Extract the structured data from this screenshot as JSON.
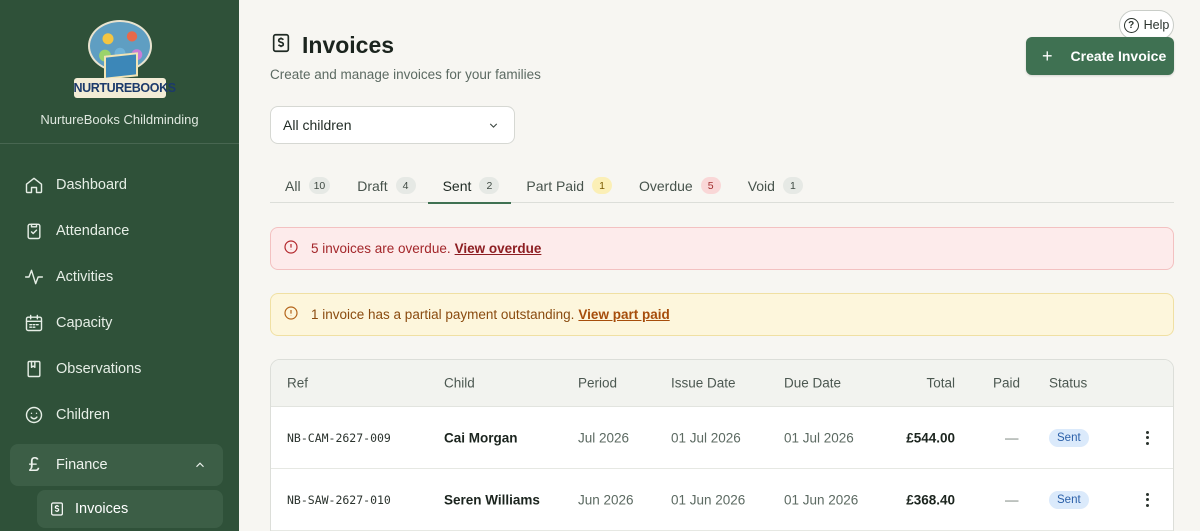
{
  "brand": {
    "logo_text": "NURTUREBOOKS",
    "name": "NurtureBooks Childminding"
  },
  "nav": {
    "items": [
      {
        "label": "Dashboard",
        "icon": "home-icon"
      },
      {
        "label": "Attendance",
        "icon": "clipboard-check-icon"
      },
      {
        "label": "Activities",
        "icon": "activity-icon"
      },
      {
        "label": "Capacity",
        "icon": "calendar-icon"
      },
      {
        "label": "Observations",
        "icon": "book-icon"
      },
      {
        "label": "Children",
        "icon": "smile-icon"
      }
    ],
    "group": {
      "label": "Finance",
      "icon": "pound-icon",
      "expanded": true
    },
    "sub": {
      "label": "Invoices",
      "icon": "invoice-icon"
    }
  },
  "header": {
    "help_label": "Help",
    "title": "Invoices",
    "subtitle": "Create and manage invoices for your families",
    "create_label": "Create Invoice"
  },
  "filter": {
    "selected": "All children"
  },
  "tabs": [
    {
      "label": "All",
      "count": "10"
    },
    {
      "label": "Draft",
      "count": "4"
    },
    {
      "label": "Sent",
      "count": "2"
    },
    {
      "label": "Part Paid",
      "count": "1"
    },
    {
      "label": "Overdue",
      "count": "5"
    },
    {
      "label": "Void",
      "count": "1"
    }
  ],
  "alerts": {
    "overdue": {
      "text": "5 invoices are overdue.",
      "link": "View overdue"
    },
    "part_paid": {
      "text": "1 invoice has a partial payment outstanding.",
      "link": "View part paid"
    }
  },
  "table": {
    "headers": {
      "ref": "Ref",
      "child": "Child",
      "period": "Period",
      "issue": "Issue Date",
      "due": "Due Date",
      "total": "Total",
      "paid": "Paid",
      "status": "Status"
    },
    "rows": [
      {
        "ref": "NB-CAM-2627-009",
        "child": "Cai Morgan",
        "period": "Jul 2026",
        "issue": "01 Jul 2026",
        "due": "01 Jul 2026",
        "total": "£544.00",
        "paid": "—",
        "status": "Sent"
      },
      {
        "ref": "NB-SAW-2627-010",
        "child": "Seren Williams",
        "period": "Jun 2026",
        "issue": "01 Jun 2026",
        "due": "01 Jun 2026",
        "total": "£368.40",
        "paid": "—",
        "status": "Sent"
      }
    ]
  },
  "colors": {
    "sidebar": "#2f5139",
    "accent": "#3f7152",
    "danger": "#a3262a",
    "warning": "#8a4b0f",
    "status_sent": "#2a5fa8"
  }
}
